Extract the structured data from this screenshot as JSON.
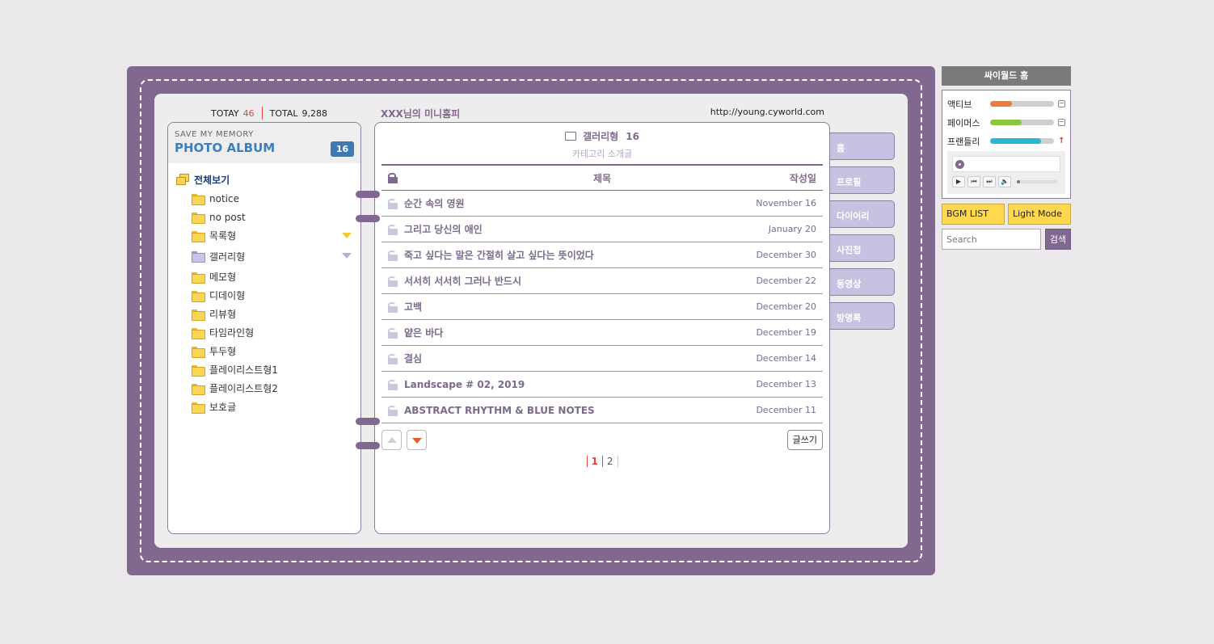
{
  "counter": {
    "today_label": "TOTAY",
    "today_value": "46",
    "total_label": "TOTAL",
    "total_value": "9,288"
  },
  "minihompy_title": "XXX님의 미니홈피",
  "url": "http://young.cyworld.com",
  "album": {
    "subtitle": "SAVE MY MEMORY",
    "title": "PHOTO ALBUM",
    "badge": "16",
    "root": "전체보기",
    "folders": [
      {
        "label": "notice"
      },
      {
        "label": "no post"
      },
      {
        "label": "목록형"
      },
      {
        "label": "갤러리형"
      },
      {
        "label": "메모형"
      },
      {
        "label": "디데이형"
      },
      {
        "label": "리뷰형"
      },
      {
        "label": "타임라인형"
      },
      {
        "label": "투두형"
      },
      {
        "label": "플레이리스트형1"
      },
      {
        "label": "플레이리스트형2"
      },
      {
        "label": "보호글"
      }
    ]
  },
  "board": {
    "category": "갤러리형",
    "count": "16",
    "description": "카테고리 소개글",
    "col_title": "제목",
    "col_date": "작성일",
    "rows": [
      {
        "title": "순간 속의 영원",
        "date": "November 16"
      },
      {
        "title": "그리고 당신의 애인",
        "date": "January 20"
      },
      {
        "title": "죽고 싶다는 말은 간절히 살고 싶다는 뜻이었다",
        "date": "December 30"
      },
      {
        "title": "서서히 서서히 그러나 반드시",
        "date": "December 22"
      },
      {
        "title": "고백",
        "date": "December 20"
      },
      {
        "title": "얕은 바다",
        "date": "December 19"
      },
      {
        "title": "결심",
        "date": "December 14"
      },
      {
        "title": "Landscape # 02, 2019",
        "date": "December 13"
      },
      {
        "title": "ABSTRACT RHYTHM & BLUE NOTES",
        "date": "December 11"
      }
    ],
    "write_label": "글쓰기",
    "pages": [
      "1",
      "2"
    ]
  },
  "tabs": [
    "홈",
    "프로필",
    "다이어리",
    "사진첩",
    "동영상",
    "방명록"
  ],
  "sidebar": {
    "home_label": "싸이월드 홈",
    "stats": [
      {
        "label": "액티브",
        "fill": 0.35,
        "color": "#ee7b3d"
      },
      {
        "label": "페이머스",
        "fill": 0.5,
        "color": "#8cc63f"
      },
      {
        "label": "프랜들리",
        "fill": 0.8,
        "color": "#2ab7d6"
      }
    ],
    "bgm_label": "BGM LIST",
    "mode_label": "Light Mode",
    "search_placeholder": "Search",
    "search_button": "검색"
  },
  "colors": {
    "accent": "#80688f",
    "tab": "#c8c2e2",
    "highlight": "#ffd84d"
  }
}
